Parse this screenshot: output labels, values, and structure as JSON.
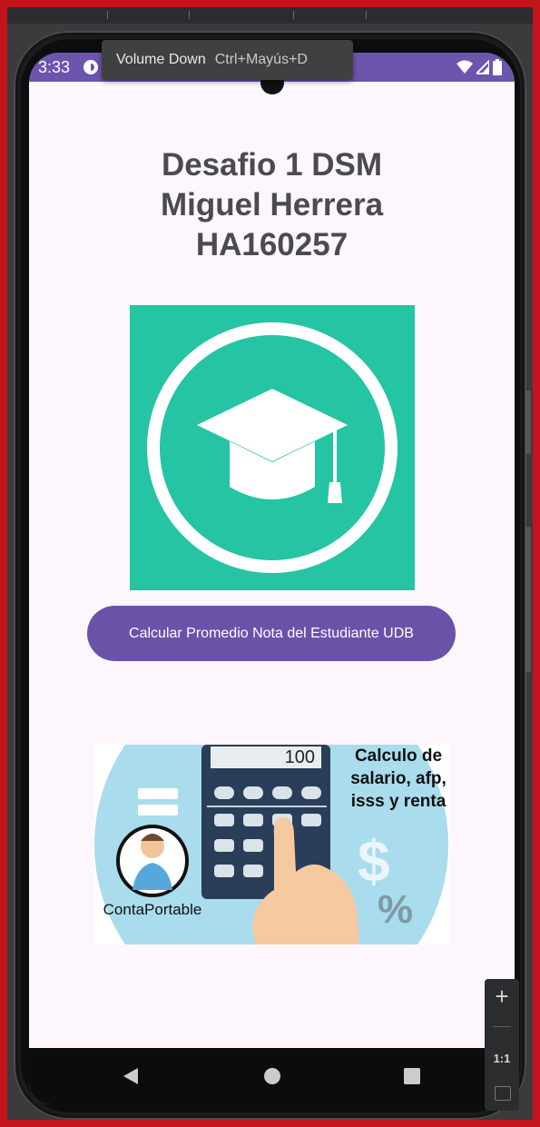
{
  "status_bar": {
    "time": "3:33",
    "background": "#6d54ad"
  },
  "tooltip": {
    "label": "Volume Down",
    "shortcut": "Ctrl+Mayús+D"
  },
  "header": {
    "title_lines": [
      "Desafio 1 DSM",
      "Miguel Herrera",
      "HA160257"
    ]
  },
  "logo": {
    "icon": "graduation-cap-icon",
    "color": "#25c4a3"
  },
  "main_button": {
    "label": "Calcular Promedio Nota del Estudiante UDB",
    "color": "#6a52a9"
  },
  "promo_image": {
    "calculator_display": "100",
    "text": "Calculo de salario, afp, isss y renta",
    "brand": "ContaPortable",
    "icons": [
      "equals-icon",
      "dollar-icon",
      "percent-icon",
      "calculator-icon",
      "pointing-hand-icon",
      "accountant-avatar-icon"
    ]
  },
  "nav_bar": {
    "items": [
      "back-icon",
      "home-icon",
      "recents-icon"
    ]
  },
  "emulator_zoom": {
    "plus": "+",
    "ratio": "1:1"
  }
}
